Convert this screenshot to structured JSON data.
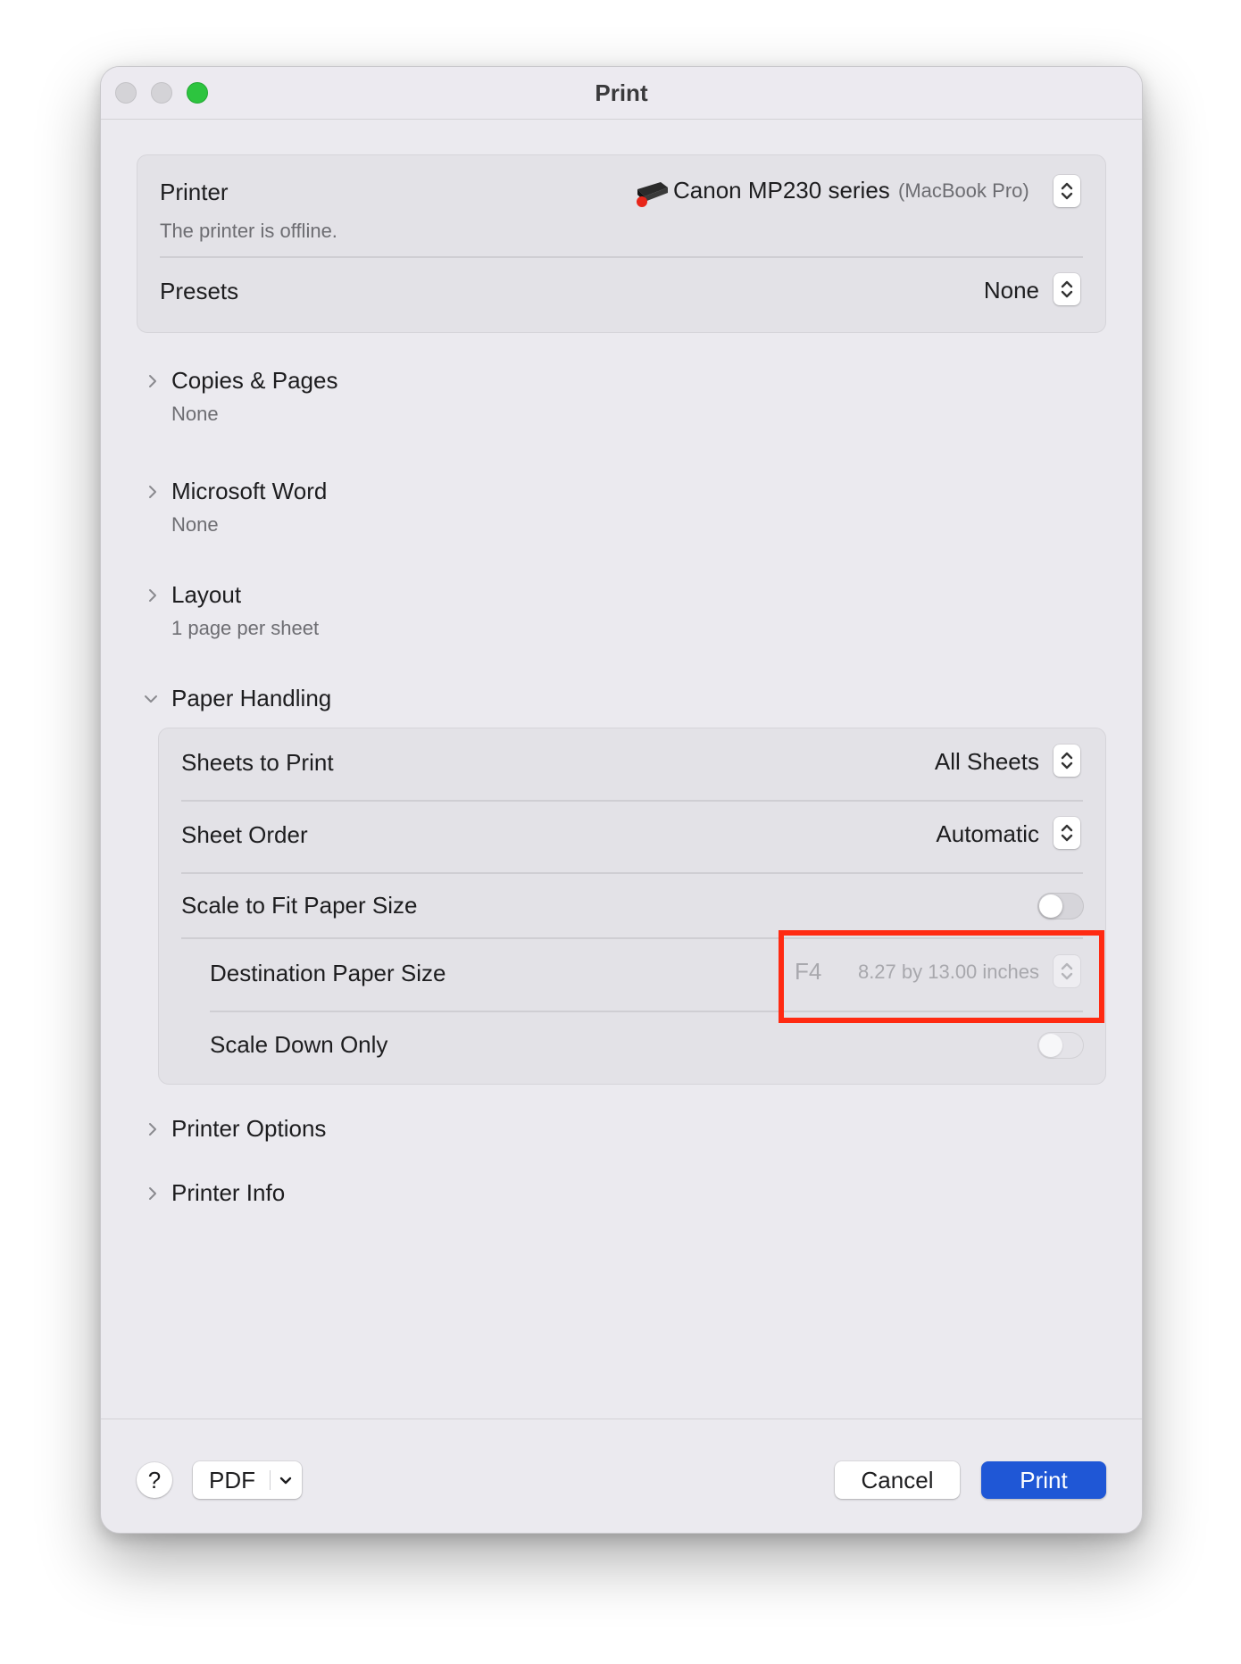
{
  "window": {
    "title": "Print"
  },
  "printer": {
    "label": "Printer",
    "name": "Canon MP230 series",
    "host": "(MacBook Pro)",
    "status": "The printer is offline.",
    "icon": "printer-icon"
  },
  "presets": {
    "label": "Presets",
    "value": "None"
  },
  "sections": {
    "copies_pages": {
      "title": "Copies & Pages",
      "summary": "None"
    },
    "microsoft_word": {
      "title": "Microsoft Word",
      "summary": "None"
    },
    "layout": {
      "title": "Layout",
      "summary": "1 page per sheet"
    },
    "paper_handling": {
      "title": "Paper Handling"
    },
    "printer_options": {
      "title": "Printer Options"
    },
    "printer_info": {
      "title": "Printer Info"
    }
  },
  "paper_handling": {
    "sheets_to_print": {
      "label": "Sheets to Print",
      "value": "All Sheets"
    },
    "sheet_order": {
      "label": "Sheet Order",
      "value": "Automatic"
    },
    "scale_to_fit": {
      "label": "Scale to Fit Paper Size",
      "on": false
    },
    "destination_paper_size": {
      "label": "Destination Paper Size",
      "size_name": "F4",
      "size_dims": "8.27 by 13.00 inches",
      "enabled": false
    },
    "scale_down_only": {
      "label": "Scale Down Only",
      "on": false,
      "enabled": false
    }
  },
  "footer": {
    "help_label": "?",
    "pdf_label": "PDF",
    "cancel_label": "Cancel",
    "print_label": "Print"
  },
  "colors": {
    "accent": "#1f57d6",
    "highlight": "#ff2a12",
    "zoom_button": "#2dc43f"
  }
}
